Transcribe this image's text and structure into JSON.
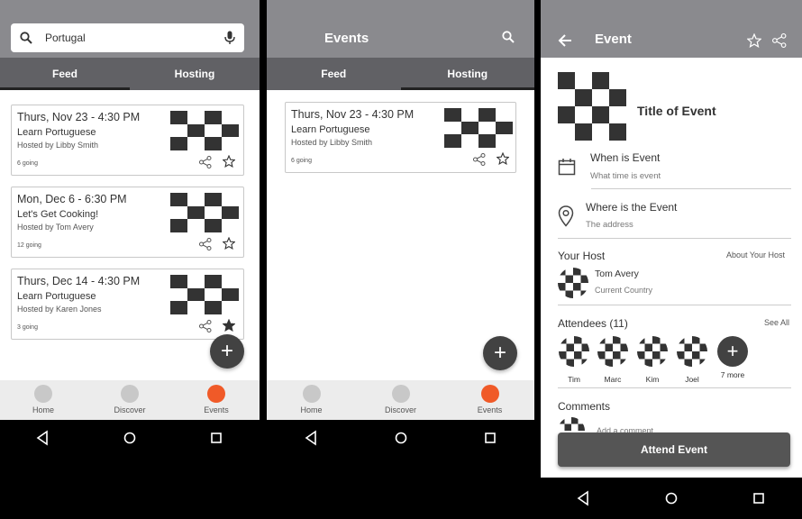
{
  "colors": {
    "appbar": "#8a8a8e",
    "tabs": "#616165",
    "accent": "#f05a28",
    "fab": "#424242",
    "button": "#555555"
  },
  "screen1": {
    "search": {
      "value": "Portugal",
      "icon": "search-icon",
      "mic_icon": "mic-icon"
    },
    "tabs": [
      {
        "label": "Feed",
        "active": true
      },
      {
        "label": "Hosting",
        "active": false
      }
    ],
    "events": [
      {
        "date": "Thurs, Nov 23 - 4:30 PM",
        "title": "Learn Portuguese",
        "host": "Hosted by Libby Smith",
        "going": "6 going",
        "starred": false
      },
      {
        "date": "Mon, Dec 6 - 6:30 PM",
        "title": "Let's Get Cooking!",
        "host": "Hosted by Tom Avery",
        "going": "12 going",
        "starred": false
      },
      {
        "date": "Thurs, Dec 14 - 4:30 PM",
        "title": "Learn Portuguese",
        "host": "Hosted by Karen Jones",
        "going": "3 going",
        "starred": true
      }
    ],
    "fab": "+",
    "bottom_nav": [
      {
        "label": "Home"
      },
      {
        "label": "Discover"
      },
      {
        "label": "Events",
        "active": true
      }
    ]
  },
  "screen2": {
    "title": "Events",
    "tabs": [
      {
        "label": "Feed",
        "active": false
      },
      {
        "label": "Hosting",
        "active": true
      }
    ],
    "events": [
      {
        "date": "Thurs, Nov 23 - 4:30 PM",
        "title": "Learn Portuguese",
        "host": "Hosted by Libby Smith",
        "going": "6 going",
        "starred": false
      }
    ],
    "fab": "+",
    "bottom_nav": [
      {
        "label": "Home"
      },
      {
        "label": "Discover"
      },
      {
        "label": "Events",
        "active": true
      }
    ]
  },
  "screen3": {
    "title": "Event",
    "event_title": "Title of Event",
    "when": {
      "title": "When is Event",
      "sub": "What time is event"
    },
    "where": {
      "title": "Where is the Event",
      "sub": "The address"
    },
    "host_section": {
      "label": "Your Host",
      "link": "About Your Host",
      "name": "Tom Avery",
      "country": "Current Country"
    },
    "attendees": {
      "label": "Attendees (11)",
      "link": "See All",
      "people": [
        "Tim",
        "Marc",
        "Kim",
        "Joel"
      ],
      "more": "7 more"
    },
    "comments": {
      "label": "Comments",
      "placeholder": "Add a comment"
    },
    "attend_button": "Attend Event"
  }
}
